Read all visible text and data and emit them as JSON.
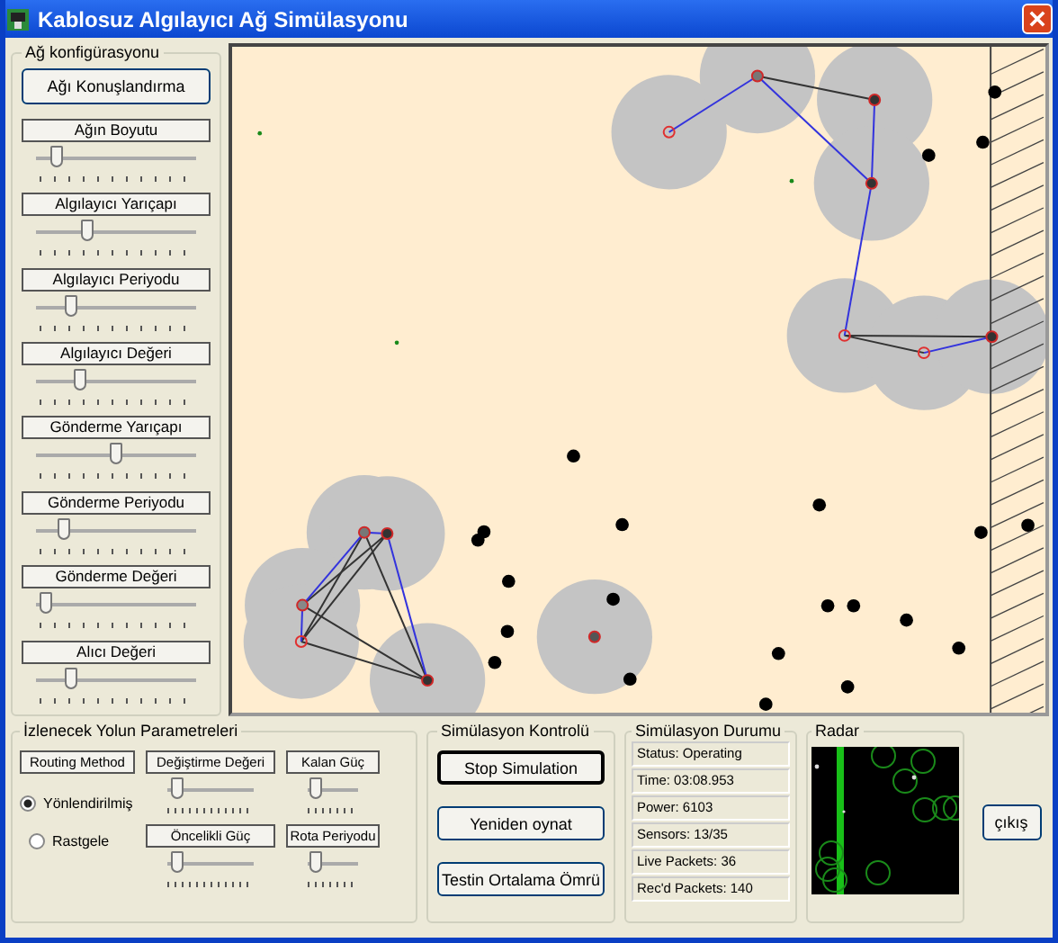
{
  "window": {
    "title": "Kablosuz Algılayıcı Ağ Simülasyonu"
  },
  "network_config": {
    "title": "Ağ konfigürasyonu",
    "deploy_button": "Ağı Konuşlandırma",
    "sliders": [
      {
        "label": "Ağın Boyutu",
        "level": 0.1
      },
      {
        "label": "Algılayıcı Yarıçapı",
        "level": 0.3
      },
      {
        "label": "Algılayıcı Periyodu",
        "level": 0.2
      },
      {
        "label": "Algılayıcı Değeri",
        "level": 0.25
      },
      {
        "label": "Gönderme Yarıçapı",
        "level": 0.5
      },
      {
        "label": "Gönderme Periyodu",
        "level": 0.15
      },
      {
        "label": "Gönderme Değeri",
        "level": 0.03
      },
      {
        "label": "Alıcı Değeri",
        "level": 0.2
      }
    ]
  },
  "route_params": {
    "title": "İzlenecek Yolun Parametreleri",
    "method_label": "Routing Method",
    "radios": [
      {
        "label": "Yönlendirilmiş",
        "selected": true
      },
      {
        "label": "Rastgele",
        "selected": false
      }
    ],
    "sliders": [
      {
        "label": "Değiştirme Değeri",
        "level": 0.05
      },
      {
        "label": "Kalan Güç",
        "level": 0.05
      },
      {
        "label": "Öncelikli Güç",
        "level": 0.05
      },
      {
        "label": "Rota Periyodu",
        "level": 0.05
      }
    ]
  },
  "sim_control": {
    "title": "Simülasyon Kontrolü",
    "buttons": [
      "Stop Simulation",
      "Yeniden oynat",
      "Testin Ortalama Ömrü"
    ]
  },
  "sim_status": {
    "title": "Simülasyon Durumu",
    "lines": [
      "Status: Operating",
      "Time: 03:08.953",
      "Power: 6103",
      "Sensors: 13/35",
      "Live Packets: 36",
      "Rec'd Packets: 140"
    ]
  },
  "radar": {
    "title": "Radar"
  },
  "exit_button": "çıkış"
}
